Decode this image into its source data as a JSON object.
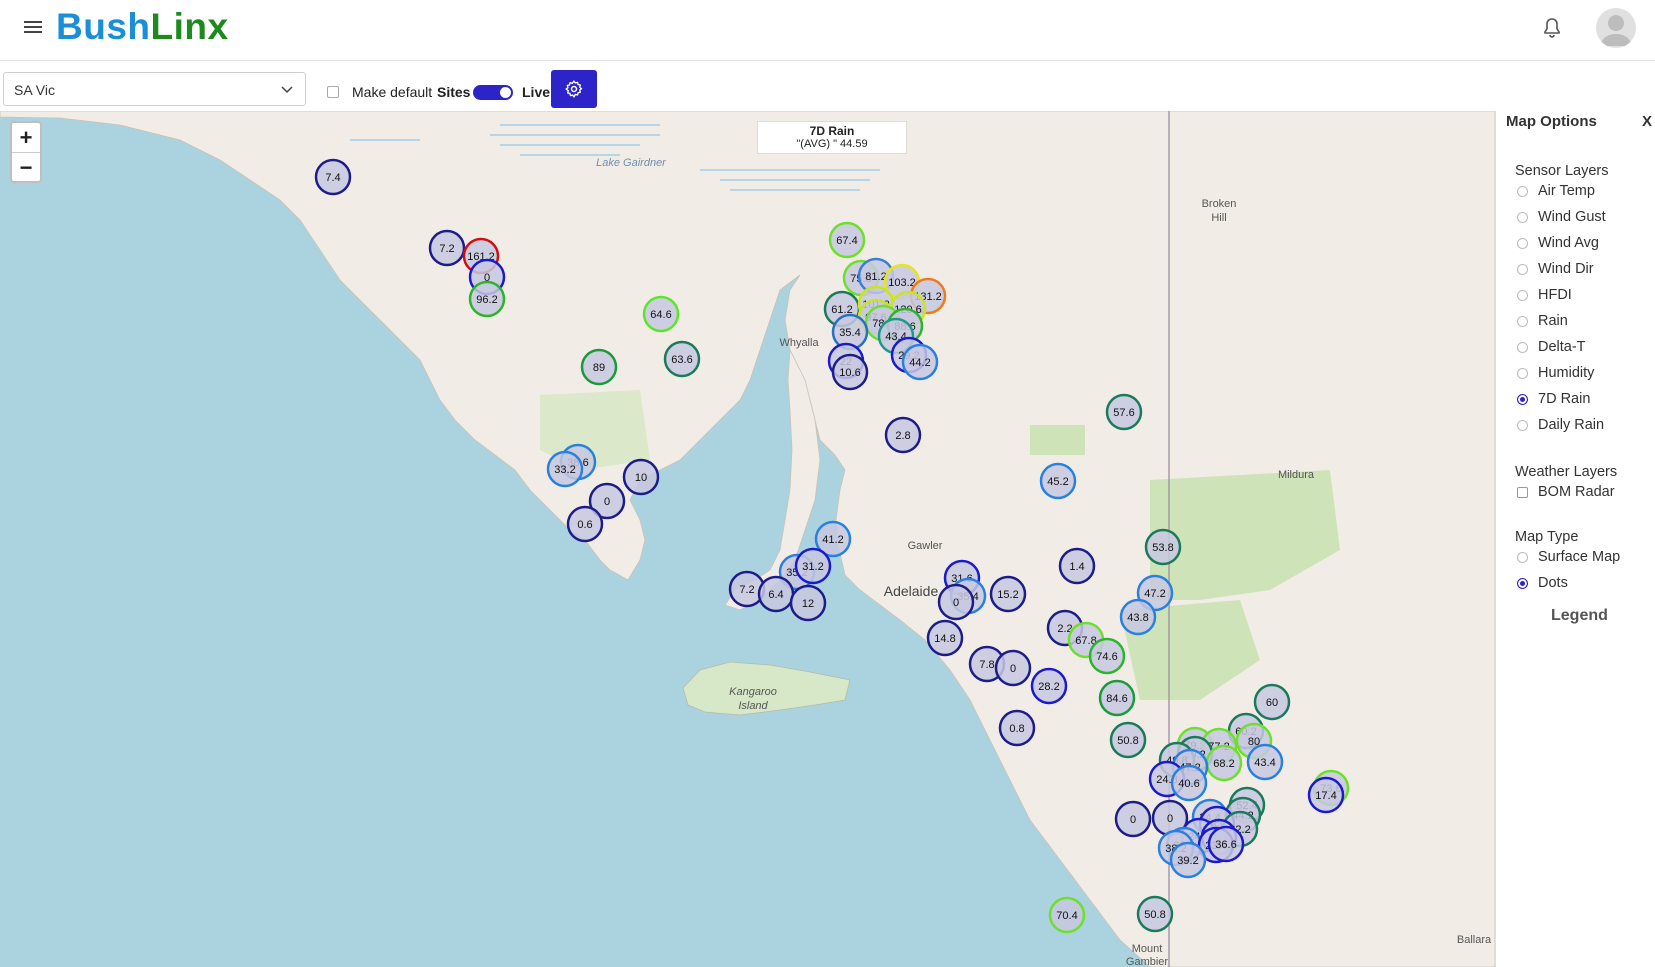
{
  "app": {
    "logo_part1": "Bush",
    "logo_part2": "Linx"
  },
  "toolbar": {
    "region_value": "SA Vic",
    "make_default_label": "Make default",
    "sites_label": "Sites",
    "live_label": "Live"
  },
  "map": {
    "zoom_in": "+",
    "zoom_out": "−",
    "avg_title": "7D Rain",
    "avg_value": "\"(AVG) \" 44.59",
    "places": {
      "lake_gairdner": "Lake Gairdner",
      "broken_hill_1": "Broken",
      "broken_hill_2": "Hill",
      "whyalla": "Whyalla",
      "mildura": "Mildura",
      "gawler": "Gawler",
      "adelaide": "Adelaide",
      "kangaroo_island_1": "Kangaroo",
      "kangaroo_island_2": "Island",
      "mount_gambier_1": "Mount",
      "mount_gambier_2": "Gambier",
      "ballarat": "Ballara"
    },
    "markers": [
      {
        "label": "7.4",
        "color": "#1d1d8a"
      },
      {
        "label": "7.2",
        "color": "#1d1d8a"
      },
      {
        "label": "161.2",
        "color": "#d01010"
      },
      {
        "label": "0",
        "color": "#1a1ad0"
      },
      {
        "label": "96.2",
        "color": "#2ab52a"
      },
      {
        "label": "64.6",
        "color": "#5ce62a"
      },
      {
        "label": "89",
        "color": "#1a9a3a"
      },
      {
        "label": "63.6",
        "color": "#1a7a5a"
      },
      {
        "label": "67.4",
        "color": "#6ce02a"
      },
      {
        "label": "75.8",
        "color": "#6ce02a"
      },
      {
        "label": "81.2",
        "color": "#3a80d0"
      },
      {
        "label": "103.2",
        "color": "#e6e61a"
      },
      {
        "label": "131.2",
        "color": "#f07a1a"
      },
      {
        "label": "61.2",
        "color": "#1a7a5a"
      },
      {
        "label": "101.8",
        "color": "#c8e61a"
      },
      {
        "label": "120.6",
        "color": "#c8e61a"
      },
      {
        "label": "97.6",
        "color": "#c8e61a"
      },
      {
        "label": "78.6",
        "color": "#6ce02a"
      },
      {
        "label": "88.6",
        "color": "#2ab52a"
      },
      {
        "label": "35.4",
        "color": "#2a70c0"
      },
      {
        "label": "43.4",
        "color": "#1a9a8a"
      },
      {
        "label": "29.2",
        "color": "#1a1ad0"
      },
      {
        "label": "44.2",
        "color": "#2a80e0"
      },
      {
        "label": "22",
        "color": "#1a1ad0"
      },
      {
        "label": "10.6",
        "color": "#1d1d8a"
      },
      {
        "label": "57.6",
        "color": "#1a7a5a"
      },
      {
        "label": "2.8",
        "color": "#1d1d8a"
      },
      {
        "label": "38.6",
        "color": "#2a80e0"
      },
      {
        "label": "33.2",
        "color": "#2a80e0"
      },
      {
        "label": "10",
        "color": "#1d1d8a"
      },
      {
        "label": "0",
        "color": "#1d1d8a"
      },
      {
        "label": "0.6",
        "color": "#1d1d8a"
      },
      {
        "label": "45.2",
        "color": "#2a80e0"
      },
      {
        "label": "41.2",
        "color": "#2a80e0"
      },
      {
        "label": "53.8",
        "color": "#1a7a5a"
      },
      {
        "label": "35.2",
        "color": "#2a80e0"
      },
      {
        "label": "31.2",
        "color": "#1a1ad0"
      },
      {
        "label": "7.2",
        "color": "#1d1d8a"
      },
      {
        "label": "6.4",
        "color": "#1d1d8a"
      },
      {
        "label": "12",
        "color": "#1d1d8a"
      },
      {
        "label": "31.6",
        "color": "#1a1ad0"
      },
      {
        "label": "35.4",
        "color": "#2a80e0"
      },
      {
        "label": "0",
        "color": "#1d1d8a"
      },
      {
        "label": "15.2",
        "color": "#1d1d8a"
      },
      {
        "label": "1.4",
        "color": "#1d1d8a"
      },
      {
        "label": "47.2",
        "color": "#2a80e0"
      },
      {
        "label": "43.8",
        "color": "#2a80e0"
      },
      {
        "label": "2.2",
        "color": "#1d1d8a"
      },
      {
        "label": "67.8",
        "color": "#6ce02a"
      },
      {
        "label": "74.6",
        "color": "#2ab52a"
      },
      {
        "label": "14.8",
        "color": "#1d1d8a"
      },
      {
        "label": "7.8",
        "color": "#1d1d8a"
      },
      {
        "label": "0",
        "color": "#1d1d8a"
      },
      {
        "label": "28.2",
        "color": "#1a1ad0"
      },
      {
        "label": "84.6",
        "color": "#1a9a3a"
      },
      {
        "label": "60",
        "color": "#1a7a5a"
      },
      {
        "label": "0.8",
        "color": "#1d1d8a"
      },
      {
        "label": "50.8",
        "color": "#1a7a5a"
      },
      {
        "label": "60.2",
        "color": "#1a7a5a"
      },
      {
        "label": "80",
        "color": "#6ce02a"
      },
      {
        "label": "79.2",
        "color": "#6ce02a"
      },
      {
        "label": "77.2",
        "color": "#6ce02a"
      },
      {
        "label": "60.2",
        "color": "#1a7a5a"
      },
      {
        "label": "68.2",
        "color": "#6ce02a"
      },
      {
        "label": "43.4",
        "color": "#2a80e0"
      },
      {
        "label": "49.8",
        "color": "#1a7a5a"
      },
      {
        "label": "47.2",
        "color": "#2a80e0"
      },
      {
        "label": "24.8",
        "color": "#1a1ad0"
      },
      {
        "label": "40.6",
        "color": "#2a80e0"
      },
      {
        "label": "73.6",
        "color": "#6ce02a"
      },
      {
        "label": "17.4",
        "color": "#1a1ad0"
      },
      {
        "label": "0",
        "color": "#1d1d8a"
      },
      {
        "label": "0",
        "color": "#1d1d8a"
      },
      {
        "label": "34.4",
        "color": "#2a80e0"
      },
      {
        "label": "52.4",
        "color": "#1a7a5a"
      },
      {
        "label": "44.2",
        "color": "#1a7a5a"
      },
      {
        "label": "33",
        "color": "#1a1ad0"
      },
      {
        "label": "62.2",
        "color": "#1a7a5a"
      },
      {
        "label": "24.2",
        "color": "#1a1ad0"
      },
      {
        "label": "20.4",
        "color": "#1a1ad0"
      },
      {
        "label": "36.6",
        "color": "#2a80e0"
      },
      {
        "label": "38.2",
        "color": "#2a80e0"
      },
      {
        "label": "23.4",
        "color": "#1a1ad0"
      },
      {
        "label": "36.6",
        "color": "#1a1ad0"
      },
      {
        "label": "39.2",
        "color": "#2a80e0"
      },
      {
        "label": "70.4",
        "color": "#6ce02a"
      },
      {
        "label": "50.8",
        "color": "#1a7a5a"
      }
    ]
  },
  "panel": {
    "title": "Map Options",
    "close": "X",
    "sensor_layers_title": "Sensor Layers",
    "sensor_layers": [
      "Air Temp",
      "Wind Gust",
      "Wind Avg",
      "Wind Dir",
      "HFDI",
      "Rain",
      "Delta-T",
      "Humidity",
      "7D Rain",
      "Daily Rain"
    ],
    "sensor_selected": "7D Rain",
    "weather_layers_title": "Weather Layers",
    "bom_radar": "BOM Radar",
    "map_type_title": "Map Type",
    "map_types": [
      "Surface Map",
      "Dots"
    ],
    "map_type_selected": "Dots",
    "legend": "Legend"
  },
  "colors": {
    "brand_blue": "#1a8fd8",
    "brand_green": "#1d8a1d",
    "accent": "#2c23c9",
    "sea": "#aad3df",
    "land": "#f1ede6"
  }
}
